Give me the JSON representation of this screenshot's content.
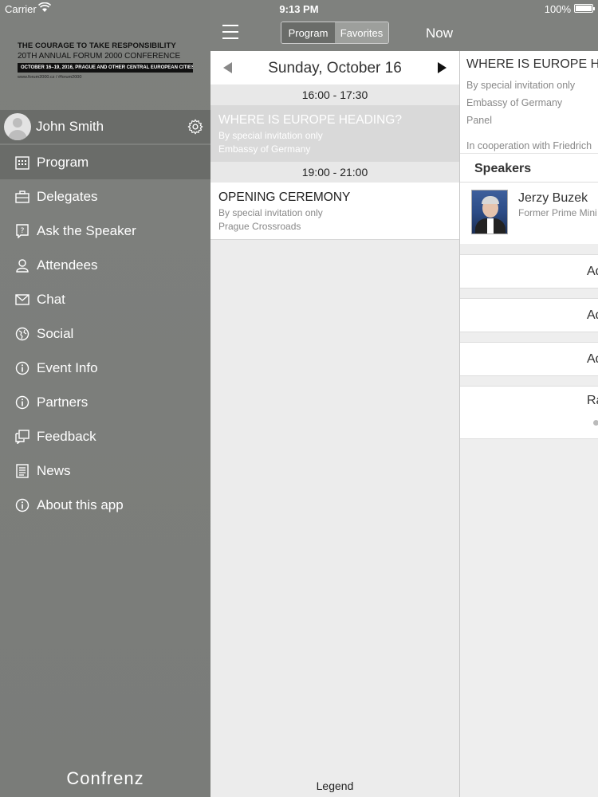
{
  "status_bar": {
    "carrier": "Carrier",
    "time": "9:13 PM",
    "battery": "100%"
  },
  "banner": {
    "line1": "THE COURAGE TO TAKE RESPONSIBILITY",
    "line2": "20TH ANNUAL FORUM 2000 CONFERENCE",
    "line3": "OCTOBER 16–19, 2016, PRAGUE AND OTHER CENTRAL EUROPEAN CITIES",
    "line4": "www.forum2000.cz / #forum2000"
  },
  "user": {
    "name": "John Smith"
  },
  "menu": {
    "items": [
      {
        "label": "Program",
        "icon": "calendar-icon"
      },
      {
        "label": "Delegates",
        "icon": "briefcase-icon"
      },
      {
        "label": "Ask the Speaker",
        "icon": "question-icon"
      },
      {
        "label": "Attendees",
        "icon": "person-icon"
      },
      {
        "label": "Chat",
        "icon": "envelope-icon"
      },
      {
        "label": "Social",
        "icon": "globe-icon"
      },
      {
        "label": "Event Info",
        "icon": "info-icon"
      },
      {
        "label": "Partners",
        "icon": "info-icon"
      },
      {
        "label": "Feedback",
        "icon": "feedback-icon"
      },
      {
        "label": "News",
        "icon": "news-icon"
      },
      {
        "label": "About this app",
        "icon": "info-icon"
      }
    ]
  },
  "sidebar_footer": "Confrenz",
  "topbar": {
    "segments": [
      "Program",
      "Favorites"
    ],
    "now_label": "Now"
  },
  "program": {
    "date": "Sunday, October 16",
    "slots": [
      {
        "time": "16:00 - 17:30",
        "session": {
          "title": "WHERE IS EUROPE HEADING?",
          "access": "By special invitation only",
          "location": "Embassy of Germany"
        }
      },
      {
        "time": "19:00 - 21:00",
        "session": {
          "title": "OPENING CEREMONY",
          "access": "By special invitation only",
          "location": "Prague Crossroads"
        }
      }
    ],
    "legend": "Legend"
  },
  "detail": {
    "title": "WHERE IS EUROPE HE",
    "access": "By special invitation only",
    "location": "Embassy of Germany",
    "type": "Panel",
    "cooperation": "In cooperation with Friedrich",
    "speakers_label": "Speakers",
    "speaker": {
      "name": "Jerzy Buzek",
      "role": "Former Prime Mini"
    },
    "actions": [
      "Ad",
      "Ad",
      "Ad"
    ],
    "rate": "Ra"
  },
  "colors": {
    "sidebar_bg": "#7e807d",
    "active_bg": "#6a6c69",
    "selected_session_bg": "#d9d9d9"
  }
}
